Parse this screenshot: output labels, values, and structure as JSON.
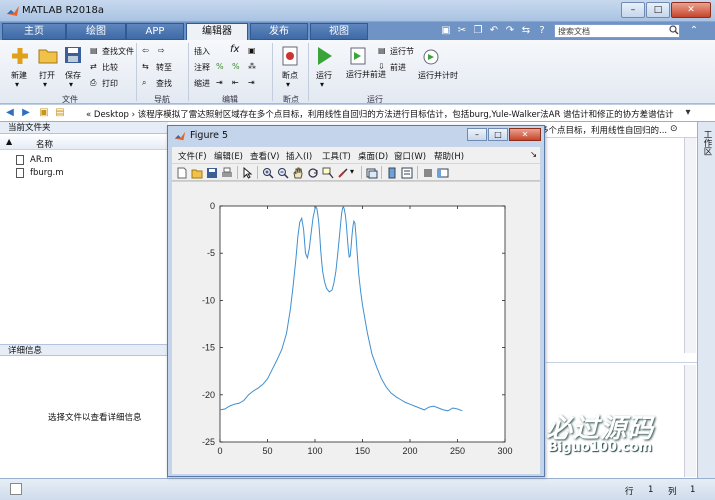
{
  "window": {
    "title": "MATLAB R2018a"
  },
  "tabs": [
    {
      "label": "主页"
    },
    {
      "label": "绘图"
    },
    {
      "label": "APP"
    },
    {
      "label": "编辑器"
    },
    {
      "label": "发布"
    },
    {
      "label": "视图"
    }
  ],
  "search": {
    "placeholder": "搜索文档"
  },
  "ribbon": {
    "file": {
      "new": "新建",
      "open": "打开",
      "save": "保存",
      "find_files": "查找文件",
      "compare": "比较",
      "print": "打印",
      "label": "文件"
    },
    "navigate": {
      "goto": "转至",
      "find": "查找",
      "label": "导航"
    },
    "edit": {
      "insert": "插入",
      "comment": "注释",
      "indent": "缩进",
      "label": "编辑"
    },
    "breakpoints": {
      "breakpoints": "断点",
      "label": "断点"
    },
    "run": {
      "run": "运行",
      "run_advance": "运行并前进",
      "run_section": "运行节",
      "advance": "前进",
      "run_time": "运行并计时",
      "label": "运行"
    }
  },
  "address": {
    "path": "« Desktop › 该程序模拟了雷达照射区域存在多个点目标，利用线性自回归的方法进行目标估计，包括burg,Yule-Walker法AR 谱估计和修正的协方差谱估计"
  },
  "left_panel": {
    "title": "当前文件夹",
    "column": "名称",
    "sort_arrow": "▲",
    "files": [
      {
        "name": "AR.m"
      },
      {
        "name": "fburg.m"
      }
    ],
    "details_title": "详细信息",
    "details_message": "选择文件以查看详细信息"
  },
  "right_panel": {
    "title_fragment": "多个点目标，利用线性自回归的..."
  },
  "side_tab": {
    "label": "工作区"
  },
  "status": {
    "row_label": "行",
    "row": "1",
    "col_label": "列",
    "col": "1"
  },
  "figure": {
    "title": "Figure 5",
    "menus": [
      "文件(F)",
      "编辑(E)",
      "查看(V)",
      "插入(I)",
      "工具(T)",
      "桌面(D)",
      "窗口(W)",
      "帮助(H)"
    ]
  },
  "watermark": {
    "cn": "必过源码",
    "en": "Biguo100.com"
  },
  "colors": {
    "series": "#3f8fd0",
    "accent": "#3e6aa6"
  },
  "chart_data": {
    "type": "line",
    "title": "",
    "xlabel": "",
    "ylabel": "",
    "xlim": [
      0,
      300
    ],
    "ylim": [
      -25,
      0
    ],
    "xticks": [
      0,
      50,
      100,
      150,
      200,
      250,
      300
    ],
    "yticks": [
      0,
      -5,
      -10,
      -15,
      -20,
      -25
    ],
    "series": [
      {
        "x": [
          0,
          5,
          10,
          15,
          20,
          25,
          30,
          35,
          40,
          45,
          50,
          55,
          60,
          65,
          70,
          74,
          77,
          80,
          82,
          84,
          86,
          88,
          90,
          92,
          94,
          96,
          98,
          100,
          101,
          102,
          103,
          104,
          105,
          106,
          107,
          108,
          110,
          112,
          115,
          118,
          120,
          122,
          124,
          126,
          127,
          128,
          129,
          130,
          131,
          132,
          133,
          134,
          135,
          136,
          137,
          138,
          139,
          140,
          141,
          142,
          143,
          144,
          145,
          146,
          148,
          150,
          155,
          160,
          165,
          170,
          175,
          180,
          185,
          190,
          195,
          200,
          205,
          210,
          215,
          220,
          225,
          230,
          235,
          240,
          245,
          250,
          255
        ],
        "y": [
          -21.6,
          -21.5,
          -21.2,
          -21.0,
          -20.9,
          -20.6,
          -20.0,
          -19.6,
          -19.3,
          -18.9,
          -18.3,
          -17.3,
          -16.3,
          -15.2,
          -13.5,
          -11.0,
          -8.5,
          -5.5,
          -3.2,
          -1.7,
          -1.3,
          -2.5,
          -5.0,
          -5.5,
          -4.5,
          -2.8,
          -1.2,
          -0.3,
          -0.1,
          -0.3,
          -0.9,
          -1.8,
          -3.2,
          -4.7,
          -5.9,
          -6.9,
          -8.0,
          -8.7,
          -9.1,
          -8.9,
          -8.1,
          -6.9,
          -5.0,
          -2.9,
          -1.8,
          -0.8,
          -0.2,
          -0.1,
          -0.4,
          -1.0,
          -2.0,
          -3.3,
          -4.6,
          -5.4,
          -5.3,
          -4.3,
          -3.1,
          -2.1,
          -1.6,
          -1.8,
          -2.9,
          -4.4,
          -5.9,
          -7.2,
          -9.0,
          -10.5,
          -13.4,
          -15.7,
          -17.1,
          -18.3,
          -19.2,
          -19.8,
          -20.2,
          -20.5,
          -20.8,
          -21.0,
          -21.2,
          -21.4,
          -21.6,
          -21.3,
          -21.2,
          -21.4,
          -21.6,
          -21.7,
          -21.4,
          -21.5,
          -21.7
        ]
      }
    ]
  }
}
